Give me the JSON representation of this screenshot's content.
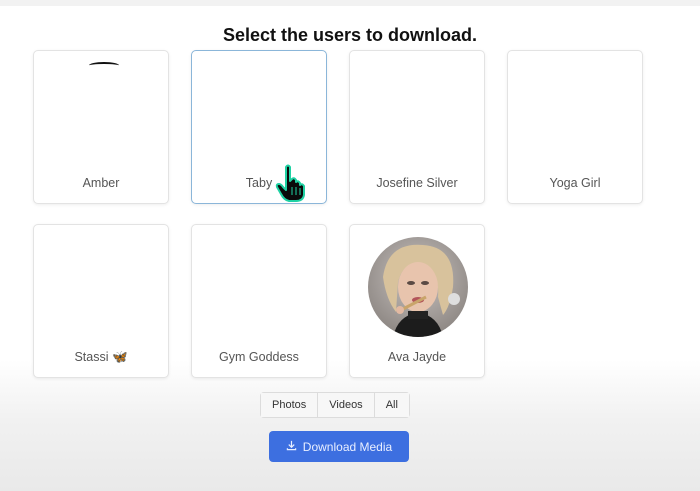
{
  "title": "Select the users to download.",
  "users": [
    {
      "name": "Amber"
    },
    {
      "name": "Taby"
    },
    {
      "name": "Josefine Silver"
    },
    {
      "name": "Yoga Girl"
    },
    {
      "name": "Stassi 🦋"
    },
    {
      "name": "Gym Goddess"
    },
    {
      "name": "Ava Jayde"
    }
  ],
  "filters": [
    "Photos",
    "Videos",
    "All"
  ],
  "download": {
    "label": "Download Media",
    "icon": "download-icon"
  },
  "colors": {
    "accent": "#3d6fe0",
    "selected_border": "#8bb6d9"
  }
}
